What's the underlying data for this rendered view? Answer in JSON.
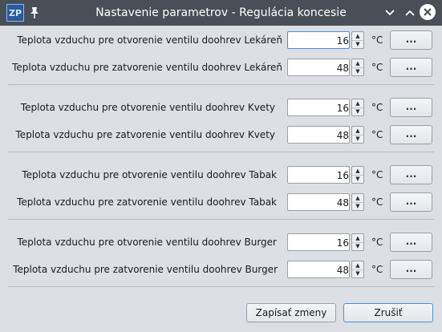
{
  "window": {
    "title": "Nastavenie parametrov - Regulácia koncesie",
    "app_icon_text": "ZP",
    "icons": {
      "app": "app-logo-icon",
      "pin": "pin-icon",
      "minimize": "chevron-down-icon",
      "maximize": "chevron-up-icon",
      "close": "close-icon"
    }
  },
  "rows": [
    {
      "label": "Teplota vzduchu pre otvorenie ventilu doohrev Lekáreň",
      "value": "16",
      "unit": "°C",
      "button": "..."
    },
    {
      "label": "Teplota vzduchu pre zatvorenie ventilu doohrev Lekáreň",
      "value": "48",
      "unit": "°C",
      "button": "..."
    },
    {
      "label": "Teplota vzduchu pre otvorenie ventilu doohrev Kvety",
      "value": "16",
      "unit": "°C",
      "button": "..."
    },
    {
      "label": "Teplota vzduchu pre zatvorenie ventilu doohrev Kvety",
      "value": "48",
      "unit": "°C",
      "button": "..."
    },
    {
      "label": "Teplota vzduchu pre otvorenie ventilu doohrev Tabak",
      "value": "16",
      "unit": "°C",
      "button": "..."
    },
    {
      "label": "Teplota vzduchu pre zatvorenie ventilu doohrev Tabak",
      "value": "48",
      "unit": "°C",
      "button": "..."
    },
    {
      "label": "Teplota vzduchu pre otvorenie ventilu doohrev Burger",
      "value": "16",
      "unit": "°C",
      "button": "..."
    },
    {
      "label": "Teplota vzduchu pre zatvorenie ventilu doohrev Burger",
      "value": "48",
      "unit": "°C",
      "button": "..."
    }
  ],
  "footer": {
    "save_label": "Zapísať zmeny",
    "cancel_label": "Zrušiť"
  },
  "colors": {
    "titlebar": "#4a4f57",
    "background": "#dcdfe4",
    "focus": "#4d8fd6"
  }
}
